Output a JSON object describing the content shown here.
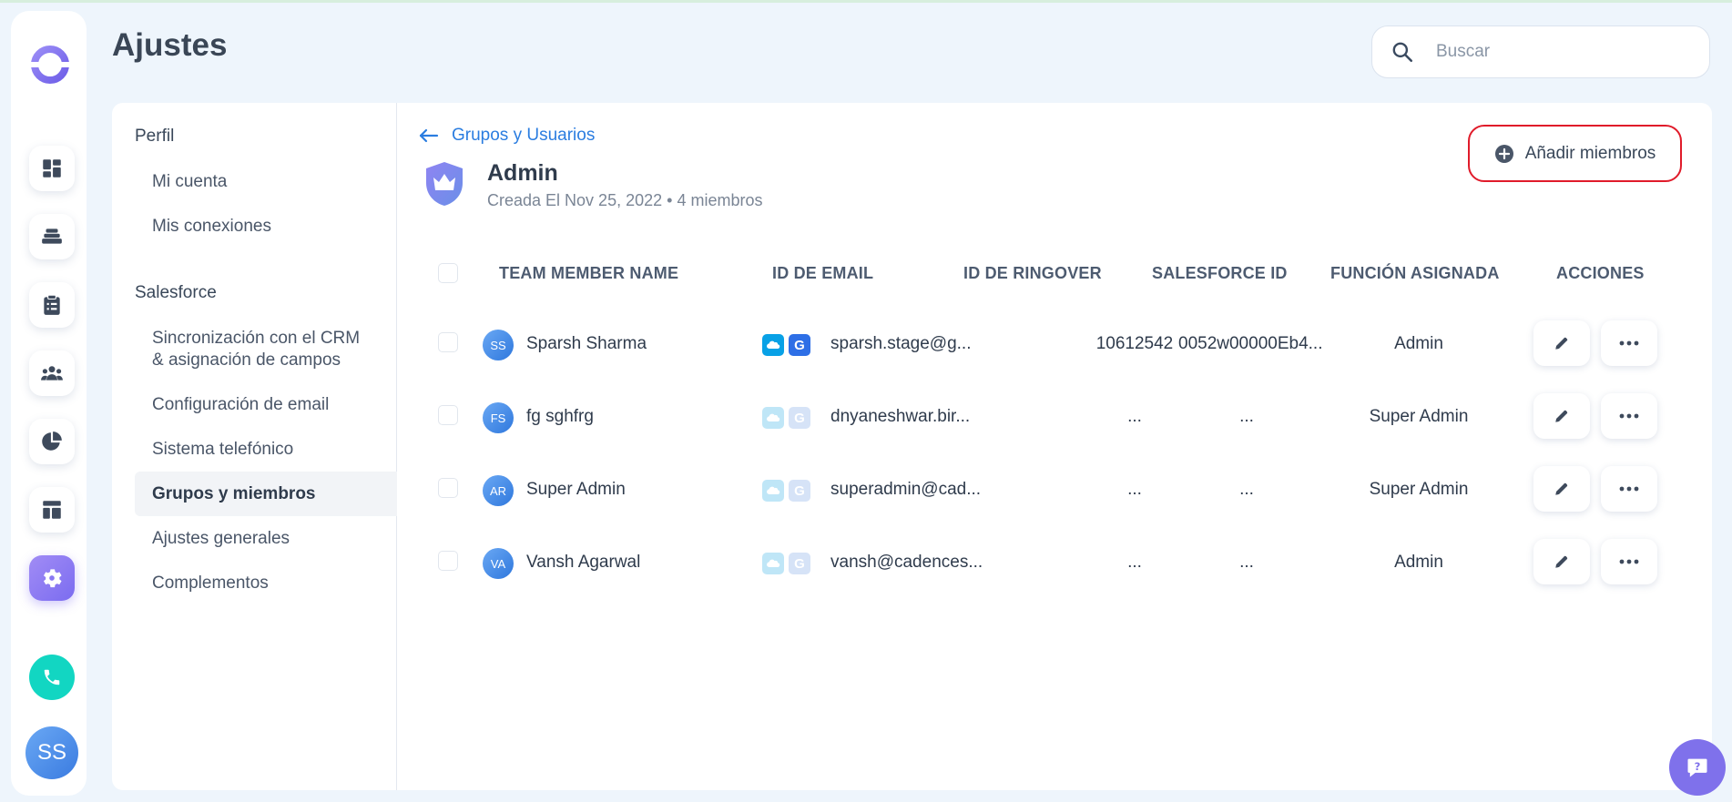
{
  "header": {
    "title": "Ajustes"
  },
  "search": {
    "placeholder": "Buscar"
  },
  "rail": {
    "items": [
      {
        "icon": "dashboard-icon"
      },
      {
        "icon": "cadence-stack-icon"
      },
      {
        "icon": "tasks-clipboard-icon"
      },
      {
        "icon": "people-icon"
      },
      {
        "icon": "reports-pie-icon"
      },
      {
        "icon": "templates-icon"
      },
      {
        "icon": "settings-gear-icon",
        "active": true
      }
    ],
    "user_initials": "SS"
  },
  "settings_nav": {
    "profile_section": "Perfil",
    "profile_items": [
      "Mi cuenta",
      "Mis conexiones"
    ],
    "salesforce_section": "Salesforce",
    "salesforce_items": [
      "Sincronización con el CRM & asignación de campos",
      "Configuración de email",
      "Sistema telefónico",
      "Grupos y miembros",
      "Ajustes generales",
      "Complementos"
    ],
    "active_item": "Grupos y miembros"
  },
  "breadcrumb": {
    "back_label": "Grupos y Usuarios"
  },
  "group": {
    "name": "Admin",
    "created": "Creada El Nov 25, 2022",
    "separator": "•",
    "members_count": "4 miembros"
  },
  "add_members_label": "Añadir miembros",
  "table": {
    "columns": [
      "TEAM MEMBER NAME",
      "ID DE EMAIL",
      "ID DE RINGOVER",
      "SALESFORCE ID",
      "FUNCIÓN ASIGNADA",
      "ACCIONES"
    ],
    "rows": [
      {
        "initials": "SS",
        "name": "Sparsh Sharma",
        "email": "sparsh.stage@g...",
        "ringover": "10612542",
        "salesforce": "0052w00000Eb4...",
        "role": "Admin",
        "connected": true
      },
      {
        "initials": "FS",
        "name": "fg sghfrg",
        "email": "dnyaneshwar.bir...",
        "ringover": "...",
        "salesforce": "...",
        "role": "Super Admin",
        "connected": false
      },
      {
        "initials": "AR",
        "name": "Super Admin",
        "email": "superadmin@cad...",
        "ringover": "...",
        "salesforce": "...",
        "role": "Super Admin",
        "connected": false
      },
      {
        "initials": "VA",
        "name": "Vansh Agarwal",
        "email": "vansh@cadences...",
        "ringover": "...",
        "salesforce": "...",
        "role": "Admin",
        "connected": false
      }
    ]
  },
  "colors": {
    "accent": "#2b7de0",
    "brand_purple": "#7f71eb",
    "highlight_border": "#e01b2a",
    "phone": "#12d6c2"
  }
}
